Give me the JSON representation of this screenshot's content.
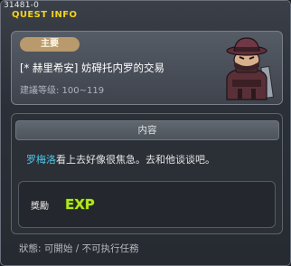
{
  "quest_id": "31481-0",
  "window_title": "QUEST INFO",
  "quest": {
    "type_badge": "主要",
    "name": "[* 赫里希安] 妨碍托内罗的交易",
    "level_range": "建議等级: 100~119"
  },
  "npc_portrait": {
    "icon": "npc-masked-bandit-icon"
  },
  "content": {
    "header": "内容",
    "npc_name": "罗梅洛",
    "description_rest": "看上去好像很焦急。去和他谈谈吧。"
  },
  "reward": {
    "label": "獎勵",
    "exp_text": "EXP"
  },
  "status": {
    "text": "狀態: 可開始 / 不可执行任務"
  },
  "colors": {
    "title": "#f2d21c",
    "npc_name": "#4fc7e8",
    "badge": "#b99a6c",
    "exp_fill": "#b6e61e"
  }
}
